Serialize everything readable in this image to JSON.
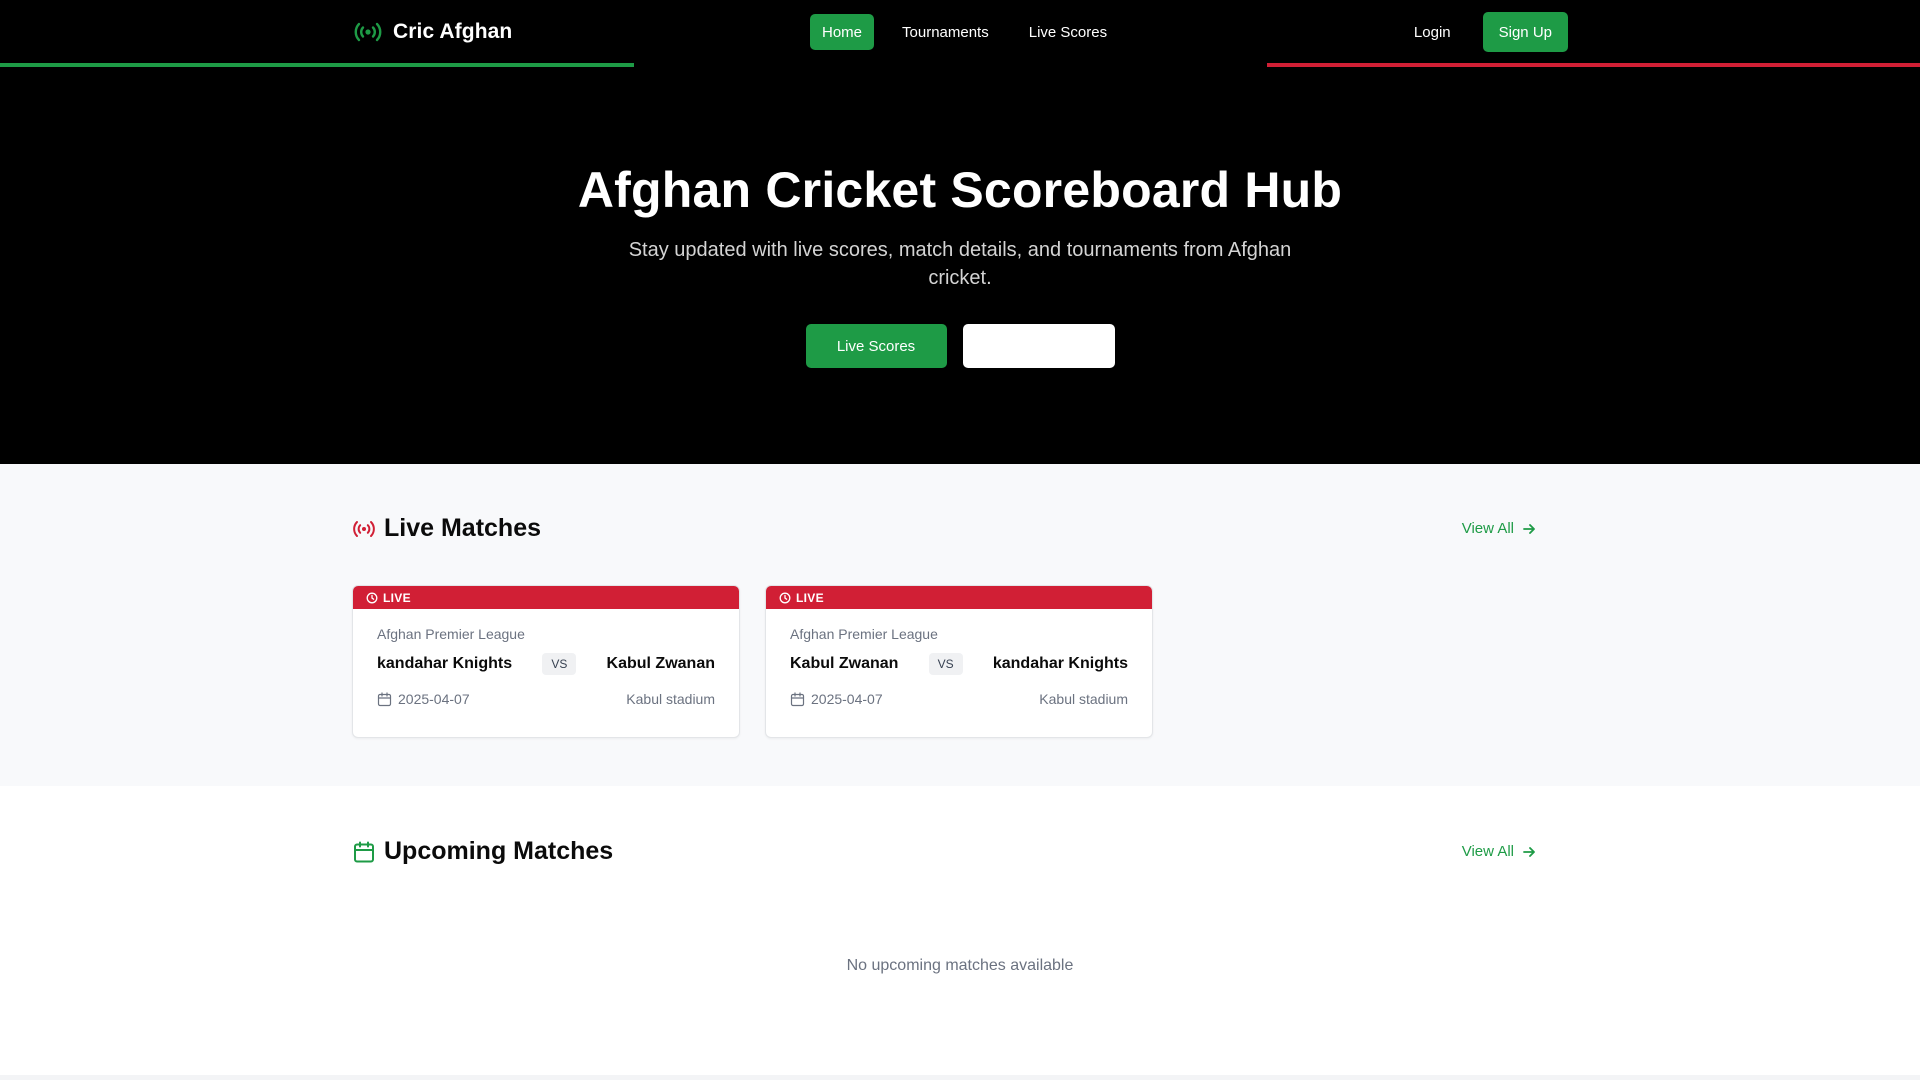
{
  "brand": {
    "name": "Cric Afghan",
    "icon": "broadcast-icon"
  },
  "nav": {
    "links": [
      "Home",
      "Tournaments",
      "Live Scores"
    ],
    "active": "Home",
    "login": "Login",
    "signup": "Sign Up"
  },
  "hero": {
    "title": "Afghan Cricket Scoreboard Hub",
    "subtitle": "Stay updated with live scores, match details, and tournaments from Afghan cricket.",
    "primary_button": "Live Scores",
    "secondary_button": ""
  },
  "live": {
    "title": "Live Matches",
    "icon": "broadcast-icon",
    "view_all": "View All",
    "matches": [
      {
        "badge": "LIVE",
        "league": "Afghan Premier League",
        "team_a": "kandahar Knights",
        "vs": "VS",
        "team_b": "Kabul Zwanan",
        "date": "2025-04-07",
        "venue": "Kabul stadium"
      },
      {
        "badge": "LIVE",
        "league": "Afghan Premier League",
        "team_a": "Kabul Zwanan",
        "vs": "VS",
        "team_b": "kandahar Knights",
        "date": "2025-04-07",
        "venue": "Kabul stadium"
      }
    ]
  },
  "upcoming": {
    "title": "Upcoming Matches",
    "icon": "calendar-icon",
    "view_all": "View All",
    "empty": "No upcoming matches available"
  },
  "colors": {
    "green": "#1e9b46",
    "red": "#d11f35",
    "black": "#000000"
  }
}
